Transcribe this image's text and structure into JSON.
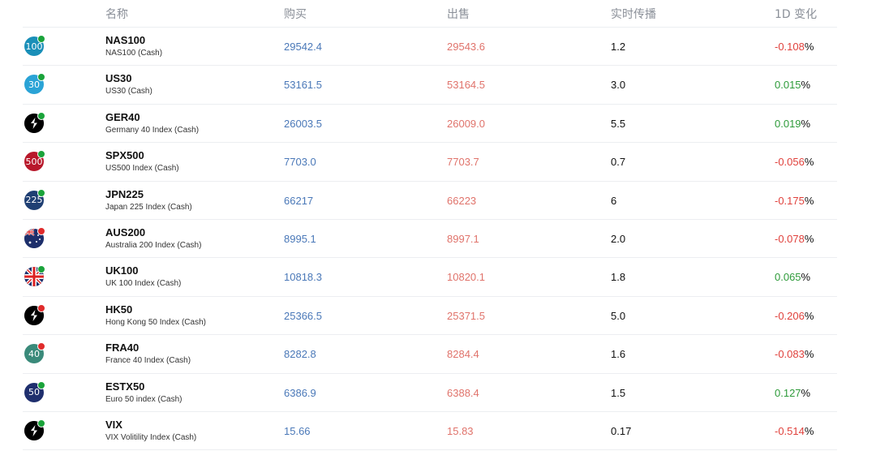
{
  "header": {
    "name": "名称",
    "buy": "购买",
    "sell": "出售",
    "spread": "实时传播",
    "change": "1D 变化"
  },
  "colors": {
    "buy": "#4a78b8",
    "sell": "#e0736b",
    "positive": "#2e9b3a",
    "negative": "#e0413c",
    "status_open": "#1aa33a",
    "status_closed": "#e02b2b"
  },
  "rows": [
    {
      "symbol": "NAS100",
      "description": "NAS100 (Cash)",
      "icon": {
        "type": "number",
        "text": "100",
        "bg": "#1a8fb8"
      },
      "status": "open",
      "buy": "29542.4",
      "sell": "29543.6",
      "spread": "1.2",
      "change": "-0.108",
      "direction": "negative"
    },
    {
      "symbol": "US30",
      "description": "US30 (Cash)",
      "icon": {
        "type": "number",
        "text": "30",
        "bg": "#2aa3d6"
      },
      "status": "open",
      "buy": "53161.5",
      "sell": "53164.5",
      "spread": "3.0",
      "change": "0.015",
      "direction": "positive"
    },
    {
      "symbol": "GER40",
      "description": "Germany 40 Index (Cash)",
      "icon": {
        "type": "logo",
        "text": "",
        "bg": "#000000"
      },
      "status": "open",
      "buy": "26003.5",
      "sell": "26009.0",
      "spread": "5.5",
      "change": "0.019",
      "direction": "positive"
    },
    {
      "symbol": "SPX500",
      "description": "US500 Index (Cash)",
      "icon": {
        "type": "number",
        "text": "500",
        "bg": "#b8182b"
      },
      "status": "open",
      "buy": "7703.0",
      "sell": "7703.7",
      "spread": "0.7",
      "change": "-0.056",
      "direction": "negative"
    },
    {
      "symbol": "JPN225",
      "description": "Japan 225 Index (Cash)",
      "icon": {
        "type": "number",
        "text": "225",
        "bg": "#1f3f73"
      },
      "status": "open",
      "buy": "66217",
      "sell": "66223",
      "spread": "6",
      "change": "-0.175",
      "direction": "negative"
    },
    {
      "symbol": "AUS200",
      "description": "Australia 200 Index (Cash)",
      "icon": {
        "type": "flag-au",
        "text": "",
        "bg": "#1d2f6b"
      },
      "status": "closed",
      "buy": "8995.1",
      "sell": "8997.1",
      "spread": "2.0",
      "change": "-0.078",
      "direction": "negative"
    },
    {
      "symbol": "UK100",
      "description": "UK 100 Index (Cash)",
      "icon": {
        "type": "flag-uk",
        "text": "",
        "bg": "#1d2f6b"
      },
      "status": "open",
      "buy": "10818.3",
      "sell": "10820.1",
      "spread": "1.8",
      "change": "0.065",
      "direction": "positive"
    },
    {
      "symbol": "HK50",
      "description": "Hong Kong 50 Index (Cash)",
      "icon": {
        "type": "logo",
        "text": "",
        "bg": "#000000"
      },
      "status": "closed",
      "buy": "25366.5",
      "sell": "25371.5",
      "spread": "5.0",
      "change": "-0.206",
      "direction": "negative"
    },
    {
      "symbol": "FRA40",
      "description": "France 40 Index (Cash)",
      "icon": {
        "type": "number",
        "text": "40",
        "bg": "#3a8a7a"
      },
      "status": "closed",
      "buy": "8282.8",
      "sell": "8284.4",
      "spread": "1.6",
      "change": "-0.083",
      "direction": "negative"
    },
    {
      "symbol": "ESTX50",
      "description": "Euro 50 index (Cash)",
      "icon": {
        "type": "number",
        "text": "50",
        "bg": "#1f2f6e"
      },
      "status": "open",
      "buy": "6386.9",
      "sell": "6388.4",
      "spread": "1.5",
      "change": "0.127",
      "direction": "positive"
    },
    {
      "symbol": "VIX",
      "description": "VIX Volitility Index (Cash)",
      "icon": {
        "type": "logo",
        "text": "",
        "bg": "#000000"
      },
      "status": "open",
      "buy": "15.66",
      "sell": "15.83",
      "spread": "0.17",
      "change": "-0.514",
      "direction": "negative"
    }
  ],
  "percent_sign": "%"
}
